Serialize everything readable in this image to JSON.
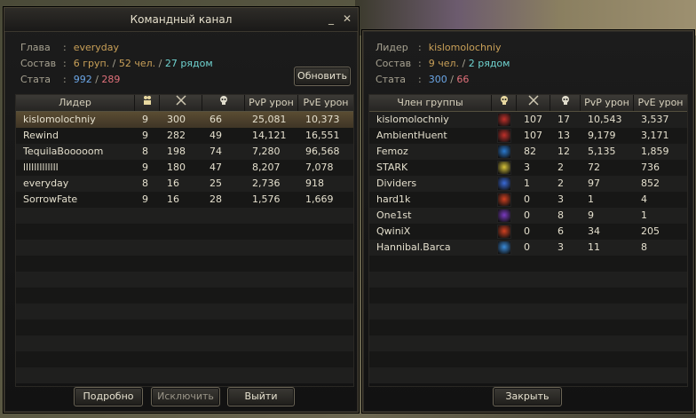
{
  "left": {
    "title": "Командный канал",
    "leader_label": "Глава",
    "leader_value": "everyday",
    "composition_label": "Состав",
    "composition_groups": "6 груп.",
    "composition_people": "52 чел.",
    "composition_near": "27 рядом",
    "stats_label": "Стата",
    "stats_a": "992",
    "stats_b": "289",
    "refresh_label": "Обновить",
    "columns": [
      "Лидер",
      "people-icon",
      "swords-icon",
      "skull-icon",
      "PvP урон",
      "PvE урон"
    ],
    "col_leader": "Лидер",
    "col_pvp": "PvP урон",
    "col_pve": "PvE урон",
    "rows": [
      {
        "name": "kislomolochniy",
        "members": "9",
        "kills": "300",
        "deaths": "66",
        "pvp": "25,081",
        "pve": "10,373"
      },
      {
        "name": "Rewind",
        "members": "9",
        "kills": "282",
        "deaths": "49",
        "pvp": "14,121",
        "pve": "16,551"
      },
      {
        "name": "TequilaBooooom",
        "members": "8",
        "kills": "198",
        "deaths": "74",
        "pvp": "7,280",
        "pve": "96,568"
      },
      {
        "name": "lllllllllllll",
        "members": "9",
        "kills": "180",
        "deaths": "47",
        "pvp": "8,207",
        "pve": "7,078"
      },
      {
        "name": "everyday",
        "members": "8",
        "kills": "16",
        "deaths": "25",
        "pvp": "2,736",
        "pve": "918"
      },
      {
        "name": "SorrowFate",
        "members": "9",
        "kills": "16",
        "deaths": "28",
        "pvp": "1,576",
        "pve": "1,669"
      }
    ],
    "details_label": "Подробно",
    "kick_label": "Исключить",
    "exit_label": "Выйти"
  },
  "right": {
    "leader_label": "Лидер",
    "leader_value": "kislomolochniy",
    "composition_label": "Состав",
    "composition_people": "9 чел.",
    "composition_near": "2 рядом",
    "stats_label": "Стата",
    "stats_a": "300",
    "stats_b": "66",
    "col_member": "Член группы",
    "col_pvp": "PvP урон",
    "col_pve": "PvE урон",
    "rows": [
      {
        "name": "kislomolochniy",
        "cls": "#c0302a",
        "kills": "107",
        "deaths": "17",
        "pvp": "10,543",
        "pve": "3,537"
      },
      {
        "name": "AmbientHuent",
        "cls": "#c0302a",
        "kills": "107",
        "deaths": "13",
        "pvp": "9,179",
        "pve": "3,171"
      },
      {
        "name": "Femoz",
        "cls": "#2a7ad0",
        "kills": "82",
        "deaths": "12",
        "pvp": "5,135",
        "pve": "1,859"
      },
      {
        "name": "STARK",
        "cls": "#d6c23a",
        "kills": "3",
        "deaths": "2",
        "pvp": "72",
        "pve": "736"
      },
      {
        "name": "Dividers",
        "cls": "#3a6ad8",
        "kills": "1",
        "deaths": "2",
        "pvp": "97",
        "pve": "852"
      },
      {
        "name": "hard1k",
        "cls": "#d04020",
        "kills": "0",
        "deaths": "3",
        "pvp": "1",
        "pve": "4"
      },
      {
        "name": "One1st",
        "cls": "#7a3ac0",
        "kills": "0",
        "deaths": "8",
        "pvp": "9",
        "pve": "1"
      },
      {
        "name": "QwiniX",
        "cls": "#d04020",
        "kills": "0",
        "deaths": "6",
        "pvp": "34",
        "pve": "205"
      },
      {
        "name": "Hannibal.Barca",
        "cls": "#3a8ad8",
        "kills": "0",
        "deaths": "3",
        "pvp": "11",
        "pve": "8"
      }
    ],
    "close_label": "Закрыть"
  }
}
